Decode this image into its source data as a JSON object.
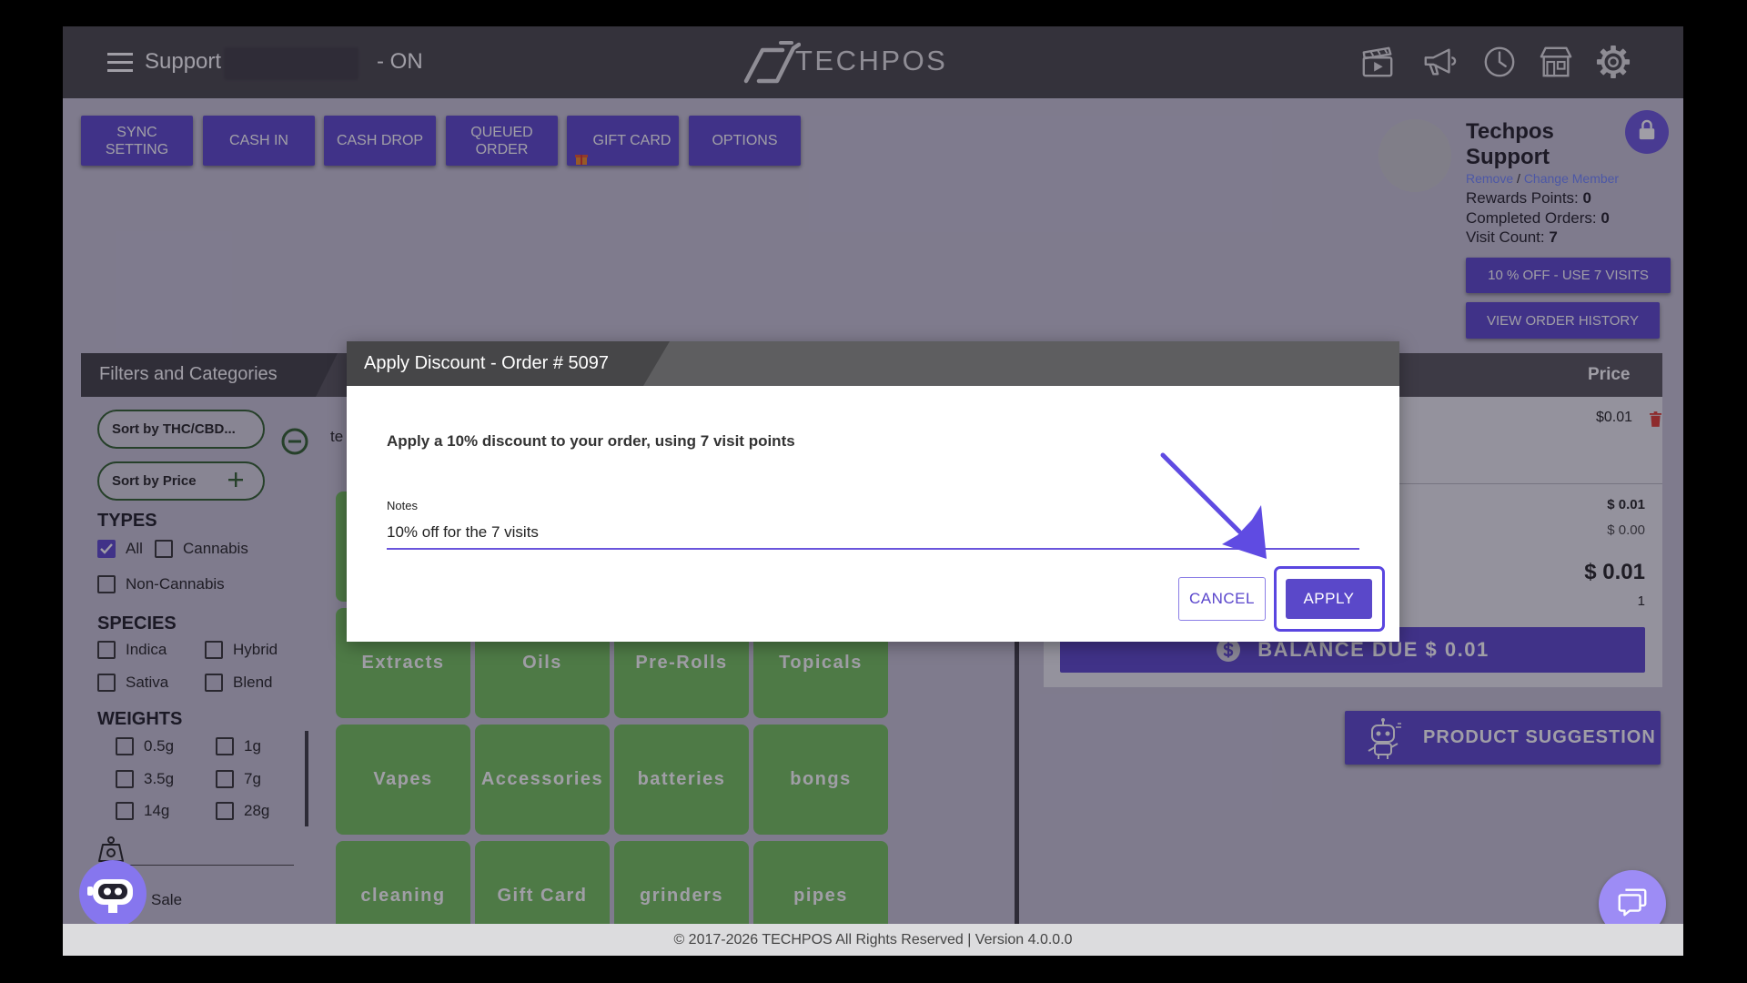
{
  "header": {
    "menu_icon": "hamburger-icon",
    "user_label": "Support",
    "status_suffix": "- ON",
    "logo_text": "TECHPOS",
    "icons": [
      "video-icon",
      "megaphone-icon",
      "clock-icon",
      "store-icon",
      "gear-icon"
    ]
  },
  "toolbar": {
    "buttons": [
      {
        "label": "SYNC\nSETTING"
      },
      {
        "label": "CASH IN"
      },
      {
        "label": "CASH DROP"
      },
      {
        "label": "QUEUED\nORDER"
      },
      {
        "label": "GIFT CARD",
        "icon": "gift-icon"
      },
      {
        "label": "OPTIONS"
      }
    ]
  },
  "customer": {
    "first_name": "Techpos",
    "last_name": "Support",
    "remove_link": "Remove",
    "separator": "/",
    "change_link": "Change Member",
    "rewards_label": "Rewards Points:",
    "rewards_value": "0",
    "completed_label": "Completed Orders:",
    "completed_value": "0",
    "visit_label": "Visit Count:",
    "visit_value": "7",
    "discount_button": "10 % OFF - USE 7 VISITS",
    "history_button": "VIEW ORDER HISTORY"
  },
  "filters": {
    "title": "Filters and Categories",
    "sort_thc": "Sort by THC/CBD...",
    "sort_price": "Sort by Price",
    "search_value": "te",
    "types_heading": "TYPES",
    "types": [
      {
        "label": "All",
        "checked": true
      },
      {
        "label": "Cannabis",
        "checked": false
      },
      {
        "label": "Non-Cannabis",
        "checked": false
      }
    ],
    "species_heading": "SPECIES",
    "species": [
      "Indica",
      "Hybrid",
      "Sativa",
      "Blend"
    ],
    "weights_heading": "WEIGHTS",
    "weights": [
      "0.5g",
      "1g",
      "3.5g",
      "7g",
      "14g",
      "28g"
    ],
    "sale_label": "Sale"
  },
  "categories": [
    "Extracts",
    "Oils",
    "Pre-Rolls",
    "Topicals",
    "Vapes",
    "Accessories",
    "batteries",
    "bongs",
    "cleaning",
    "Gift Card",
    "grinders",
    "pipes"
  ],
  "cart": {
    "price_header": "Price",
    "item_price": "$0.01",
    "subtotal": "$ 0.01",
    "tax": "$ 0.00",
    "total": "$ 0.01",
    "item_count": "1",
    "balance_due": "BALANCE DUE $ 0.01",
    "product_suggestion": "PRODUCT SUGGESTION"
  },
  "modal": {
    "title": "Apply Discount - Order # 5097",
    "message": "Apply a 10% discount to your order, using 7 visit points",
    "notes_label": "Notes",
    "notes_value": "10% off for the 7 visits",
    "cancel_label": "CANCEL",
    "apply_label": "APPLY"
  },
  "footer": {
    "text": "© 2017-2026 TECHPOS All Rights Reserved | Version 4.0.0.0"
  },
  "colors": {
    "accent": "#5a46cc",
    "category_tile": "#72c25a",
    "header_bg": "#464548",
    "danger": "#e03a2f",
    "chat_fab": "#9d8cf5"
  }
}
